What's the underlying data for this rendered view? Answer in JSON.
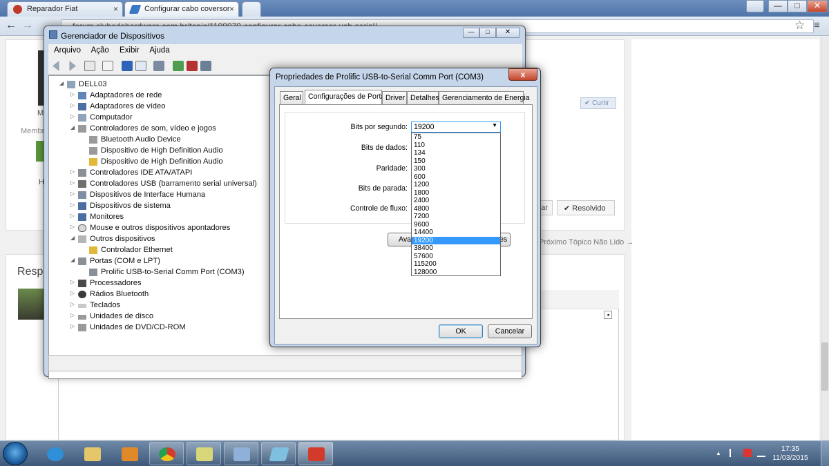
{
  "browser": {
    "tabs": [
      {
        "label": "Reparador Fiat",
        "close": "×"
      },
      {
        "label": "Configurar cabo coversor",
        "close": "×"
      }
    ],
    "url": "forum.clubedohardware.com.br/topic/1108070-configurar-cabo-coversor-usb-serial/",
    "window_controls": [
      "—",
      "□",
      "✕"
    ]
  },
  "page": {
    "like_button": "Curtir",
    "resolved_button": "Resolvido",
    "next_topic": "Próximo Tópico Não Lido →",
    "reply_heading": "Resp",
    "member_label": "Membr",
    "partial_m": "M",
    "partial_h": "H"
  },
  "device_manager": {
    "title": "Gerenciador de Dispositivos",
    "menu": [
      "Arquivo",
      "Ação",
      "Exibir",
      "Ajuda"
    ],
    "tree": [
      {
        "label": "DELL03",
        "level": 0,
        "expanded": true
      },
      {
        "label": "Adaptadores de rede",
        "level": 1
      },
      {
        "label": "Adaptadores de vídeo",
        "level": 1
      },
      {
        "label": "Computador",
        "level": 1
      },
      {
        "label": "Controladores de som, vídeo e jogos",
        "level": 1,
        "expanded": true
      },
      {
        "label": "Bluetooth Audio Device",
        "level": 2
      },
      {
        "label": "Dispositivo de High Definition Audio",
        "level": 2
      },
      {
        "label": "Dispositivo de High Definition Audio",
        "level": 2,
        "warning": true
      },
      {
        "label": "Controladores IDE ATA/ATAPI",
        "level": 1
      },
      {
        "label": "Controladores USB (barramento serial universal)",
        "level": 1
      },
      {
        "label": "Dispositivos de Interface Humana",
        "level": 1
      },
      {
        "label": "Dispositivos de sistema",
        "level": 1
      },
      {
        "label": "Monitores",
        "level": 1
      },
      {
        "label": "Mouse e outros dispositivos apontadores",
        "level": 1
      },
      {
        "label": "Outros dispositivos",
        "level": 1,
        "expanded": true
      },
      {
        "label": "Controlador Ethernet",
        "level": 2,
        "warning": true
      },
      {
        "label": "Portas (COM e LPT)",
        "level": 1,
        "expanded": true
      },
      {
        "label": "Prolific USB-to-Serial Comm Port (COM3)",
        "level": 2
      },
      {
        "label": "Processadores",
        "level": 1
      },
      {
        "label": "Rádios Bluetooth",
        "level": 1
      },
      {
        "label": "Teclados",
        "level": 1
      },
      {
        "label": "Unidades de disco",
        "level": 1
      },
      {
        "label": "Unidades de DVD/CD-ROM",
        "level": 1
      }
    ]
  },
  "properties": {
    "title": "Propriedades de Prolific USB-to-Serial Comm Port (COM3)",
    "close": "x",
    "tabs": [
      "Geral",
      "Configurações de Porta",
      "Driver",
      "Detalhes",
      "Gerenciamento de Energia"
    ],
    "active_tab": "Configurações de Porta",
    "labels": {
      "bits_per_second": "Bits por segundo:",
      "data_bits": "Bits de dados:",
      "parity": "Paridade:",
      "stop_bits": "Bits de parada:",
      "flow_control": "Controle de fluxo:"
    },
    "baud_selected": "19200",
    "baud_options": [
      "75",
      "110",
      "134",
      "150",
      "300",
      "600",
      "1200",
      "1800",
      "2400",
      "4800",
      "7200",
      "9600",
      "14400",
      "19200",
      "38400",
      "57600",
      "115200",
      "128000"
    ],
    "advanced_button": "Ava",
    "restore_button_tail": "es",
    "ok": "OK",
    "cancel": "Cancelar"
  },
  "taskbar": {
    "time": "17:35",
    "date": "11/03/2015",
    "tray_arrow": "▲"
  },
  "colors": {
    "selection": "#3399ff",
    "title_glass": "#c5d5ea",
    "close_red": "#c4452d"
  }
}
